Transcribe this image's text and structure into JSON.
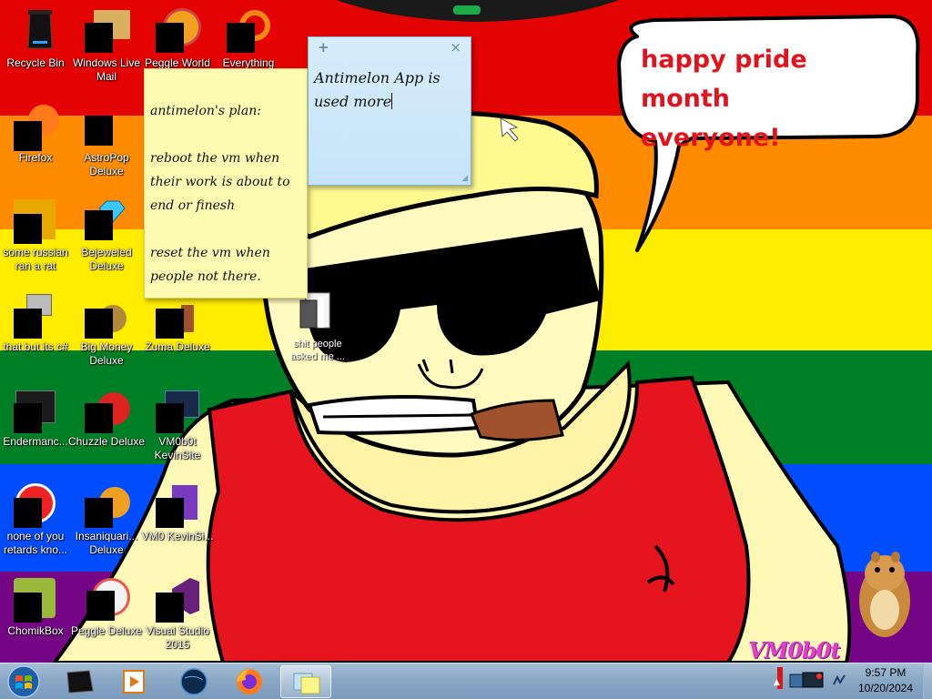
{
  "wallpaper": {
    "speech_line1": "happy pride month",
    "speech_line2": "everyone!",
    "watermark": "VM0b0t"
  },
  "desktop_icons": [
    {
      "label": "Recycle Bin",
      "icon": "recycle-bin-icon"
    },
    {
      "label": "Windows Live Mail",
      "icon": "mail-app-icon"
    },
    {
      "label": "Peggle World",
      "icon": "game-icon"
    },
    {
      "label": "Everything",
      "icon": "search-app-icon"
    },
    {
      "label": "Firefox",
      "icon": "firefox-icon"
    },
    {
      "label": "AstroPop Deluxe",
      "icon": "game-icon"
    },
    {
      "label": "some russian ran a rat",
      "icon": "app-icon"
    },
    {
      "label": "Bejeweled Deluxe",
      "icon": "gem-game-icon"
    },
    {
      "label": "that but its c#",
      "icon": "app-icon"
    },
    {
      "label": "Big Money Deluxe",
      "icon": "money-bag-icon"
    },
    {
      "label": "Zuma Deluxe",
      "icon": "game-icon"
    },
    {
      "label": "Endermanc...",
      "icon": "terminal-icon"
    },
    {
      "label": "Chuzzle Deluxe",
      "icon": "game-icon"
    },
    {
      "label": "VM0b0t KevinSite",
      "icon": "shortcut-icon"
    },
    {
      "label": "none of you retards kno...",
      "icon": "app-icon"
    },
    {
      "label": "Insaniquari... Deluxe",
      "icon": "game-icon"
    },
    {
      "label": "VM0 KevinSi...",
      "icon": "shortcut-icon"
    },
    {
      "label": "ChomikBox",
      "icon": "hamster-app-icon"
    },
    {
      "label": "Peggle Deluxe",
      "icon": "game-icon"
    },
    {
      "label": "Visual Studio 2015",
      "icon": "visual-studio-icon"
    }
  ],
  "file_icon": {
    "label": "shit people asked me ..."
  },
  "sticky_yellow": {
    "text": "antimelon's plan:\n\nreboot the vm when their work is about to end or finesh\n\nreset the vm when people not there."
  },
  "sticky_blue": {
    "add_label": "+",
    "close_label": "×",
    "text": "Antimelon App is used more"
  },
  "taskbar": {
    "pinned": [
      {
        "name": "taskbar-app-1",
        "icon": "black-box-icon"
      },
      {
        "name": "taskbar-media-player",
        "icon": "media-player-icon"
      },
      {
        "name": "taskbar-globe",
        "icon": "globe-icon"
      },
      {
        "name": "taskbar-firefox",
        "icon": "firefox-icon"
      },
      {
        "name": "taskbar-sticky-notes",
        "icon": "sticky-notes-icon"
      }
    ],
    "clock_time": "9:57 PM",
    "clock_date": "10/20/2024"
  },
  "colors": {
    "stripe_red": "#e40303",
    "stripe_orange": "#ff8c00",
    "stripe_yellow": "#ffed00",
    "stripe_green": "#008026",
    "stripe_blue": "#004dff",
    "stripe_purple": "#750787",
    "speech_text": "#e0141e",
    "sticky_yellow": "#fdfbb2",
    "sticky_blue": "#c6e4f9"
  }
}
